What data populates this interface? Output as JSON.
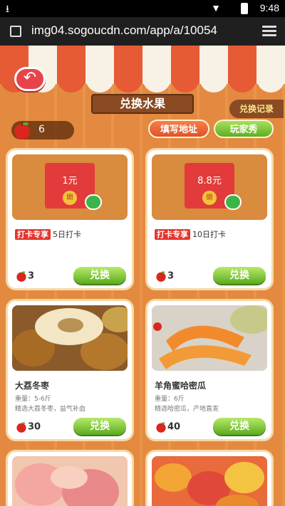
{
  "status_bar": {
    "time": "9:48"
  },
  "browser": {
    "url": "img04.sogoucdn.com/app/a/10054"
  },
  "game": {
    "title": "兑换水果",
    "history_label": "兑换记录",
    "balance": "6",
    "address_label": "填写地址",
    "show_label": "玩家秀",
    "redeem_label": "兑换",
    "red_packet_seal": "開",
    "cards": [
      {
        "type": "redpacket",
        "amount": "1元",
        "tag": "打卡专享",
        "desc": "5日打卡",
        "price": "3"
      },
      {
        "type": "redpacket",
        "amount": "8.8元",
        "tag": "打卡专享",
        "desc": "10日打卡",
        "price": "3"
      },
      {
        "type": "fruit",
        "name": "大荔冬枣",
        "weight": "重量：5-6斤",
        "desc": "精选大荔冬枣，益气补血",
        "price": "30"
      },
      {
        "type": "fruit",
        "name": "羊角蜜哈密瓜",
        "weight": "重量：6斤",
        "desc": "精选哈密瓜，产地直发",
        "price": "40"
      }
    ]
  },
  "colors": {
    "accent_green": "#5daf22",
    "accent_red": "#e5352d",
    "wood": "#8a4a24"
  }
}
